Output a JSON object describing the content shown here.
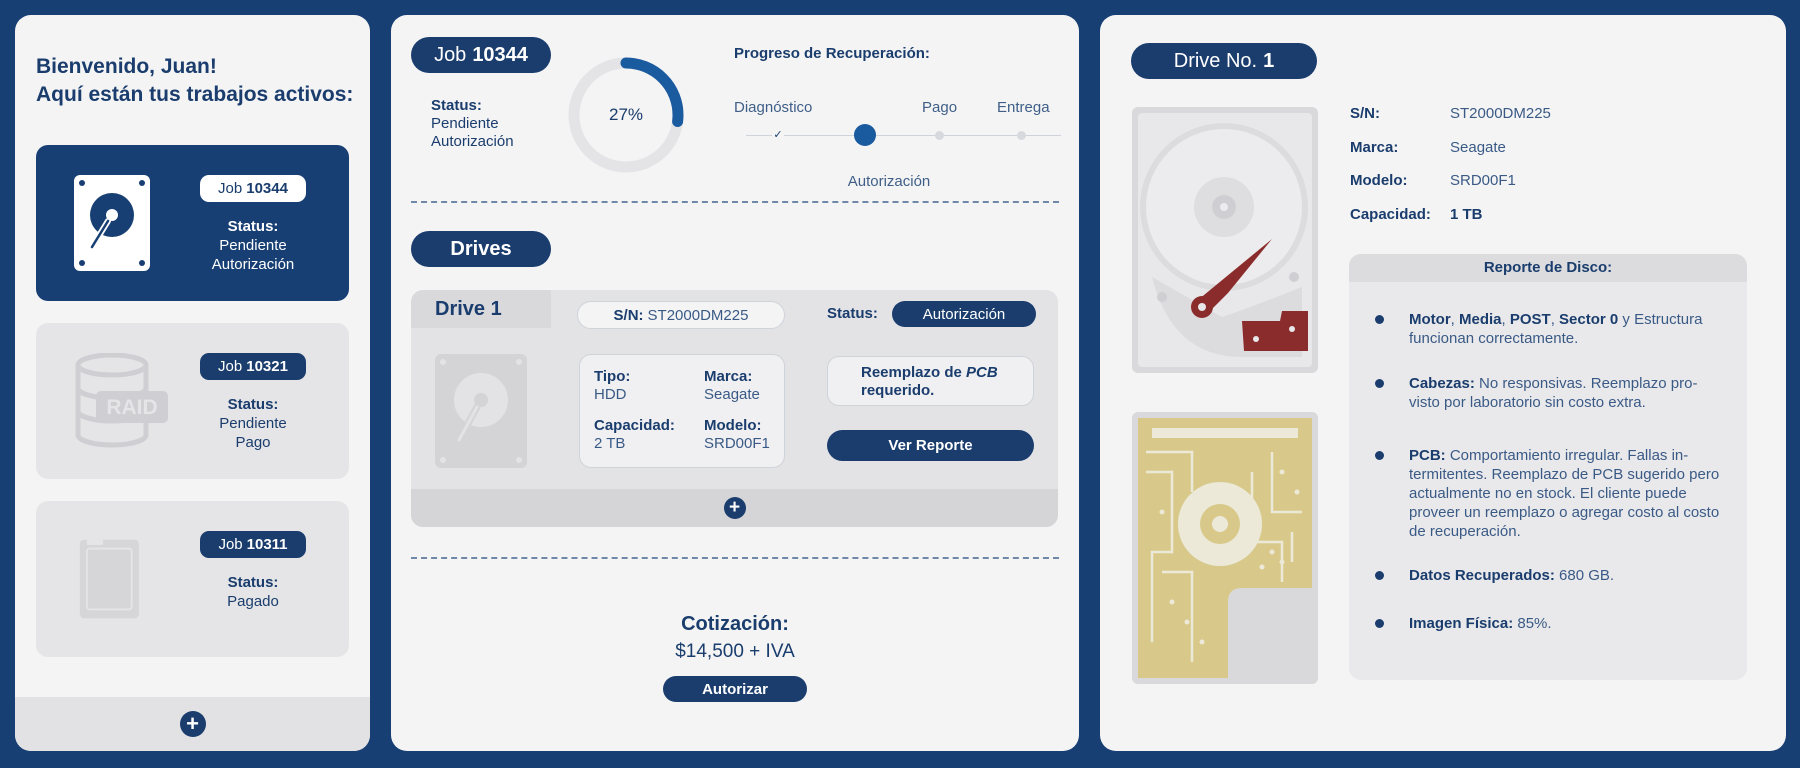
{
  "sidebar": {
    "welcome_line1": "Bienvenido, Juan!",
    "welcome_line2": "Aquí están tus trabajos activos:",
    "jobs": [
      {
        "prefix": "Job",
        "number": "10344",
        "status_label": "Status:",
        "status_line1": "Pendiente",
        "status_line2": "Autorización",
        "icon": "hard-drive-icon",
        "active": true
      },
      {
        "prefix": "Job",
        "number": "10321",
        "status_label": "Status:",
        "status_line1": "Pendiente",
        "status_line2": "Pago",
        "icon": "raid-icon",
        "icon_text": "RAID",
        "active": false
      },
      {
        "prefix": "Job",
        "number": "10311",
        "status_label": "Status:",
        "status_line1": "Pagado",
        "status_line2": "",
        "icon": "ssd-icon",
        "active": false
      }
    ],
    "add_icon": "+"
  },
  "job": {
    "prefix": "Job",
    "number": "10344",
    "status_label": "Status:",
    "status_line1": "Pendiente",
    "status_line2": "Autorización",
    "progress_fraction": 0.27,
    "progress_label": "27%",
    "progress_title": "Progreso de Recuperación:",
    "steps": [
      "Diagnóstico",
      "Autorización",
      "Pago",
      "Entrega"
    ]
  },
  "drives": {
    "title": "Drives",
    "drive": {
      "tab_label": "Drive 1",
      "sn_label": "S/N:",
      "sn_value": "ST2000DM225",
      "status_label": "Status:",
      "status_value": "Autorización",
      "tipo_label": "Tipo:",
      "tipo_value": "HDD",
      "marca_label": "Marca:",
      "marca_value": "Seagate",
      "capacidad_label": "Capacidad:",
      "capacidad_value": "2 TB",
      "modelo_label": "Modelo:",
      "modelo_value": "SRD00F1",
      "note_line1": "Reemplazo de",
      "note_em": "PCB",
      "note_line2": "requerido.",
      "report_button": "Ver Reporte"
    },
    "add_icon": "+"
  },
  "quote": {
    "title": "Cotización:",
    "value": "$14,500 + IVA",
    "button": "Autorizar"
  },
  "drive_detail": {
    "title_prefix": "Drive No.",
    "title_number": "1",
    "sn_label": "S/N:",
    "sn_value": "ST2000DM225",
    "marca_label": "Marca:",
    "marca_value": "Seagate",
    "modelo_label": "Modelo:",
    "modelo_value": "SRD00F1",
    "capacidad_label": "Capacidad:",
    "capacidad_value": "1 TB",
    "report": {
      "title": "Reporte de Disco:",
      "item1": {
        "b1": "Motor",
        "t1": ", ",
        "b2": "Media",
        "t2": ", ",
        "b3": "POST",
        "t3": ", ",
        "b4": "Sector 0",
        "t4": " y Estructura funcionan correctamente."
      },
      "item2": {
        "b": "Cabezas:",
        "t": " No responsivas. Reemplazo pro-visto por laboratorio sin costo extra."
      },
      "item3": {
        "b": "PCB:",
        "t": " Comportamiento irregular. Fallas in-termitentes. Reemplazo de PCB sugerido pero actualmente no en stock. El cliente puede proveer un reemplazo o agregar costo al costo de recuperación."
      },
      "item4": {
        "b": "Datos Recuperados:",
        "t": " 680 GB."
      },
      "item5": {
        "b": "Imagen Física:",
        "t": " 85%."
      }
    }
  },
  "colors": {
    "brand": "#173f73",
    "accent": "#1a3d6d",
    "panel": "#f4f4f5",
    "pcb": "#d8c98a",
    "head": "#8b2c2c"
  }
}
